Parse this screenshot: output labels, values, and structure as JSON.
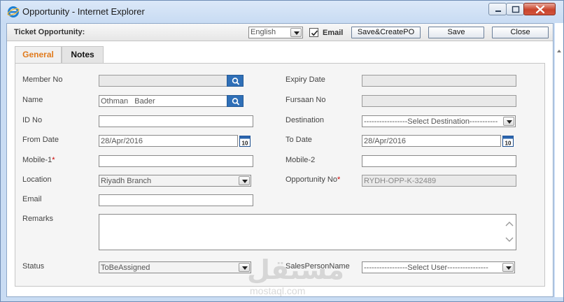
{
  "window": {
    "title": "Opportunity - Internet Explorer"
  },
  "toolbar": {
    "title": "Ticket Opportunity:",
    "language": "English",
    "email_label": "Email",
    "email_checked": true,
    "save_po_label": "Save&CreatePO",
    "save_label": "Save",
    "close_label": "Close"
  },
  "tabs": [
    {
      "label": "General",
      "active": true
    },
    {
      "label": "Notes",
      "active": false
    }
  ],
  "form": {
    "member_no": {
      "label": "Member No",
      "value": ""
    },
    "expiry_date": {
      "label": "Expiry Date",
      "value": ""
    },
    "name": {
      "label": "Name",
      "value": "Othman   Bader"
    },
    "fursaan_no": {
      "label": "Fursaan No",
      "value": ""
    },
    "id_no": {
      "label": "ID No",
      "value": ""
    },
    "destination": {
      "label": "Destination",
      "value": "-----------------Select Destination-----------"
    },
    "from_date": {
      "label": "From Date",
      "value": "28/Apr/2016"
    },
    "to_date": {
      "label": "To Date",
      "value": "28/Apr/2016"
    },
    "mobile1": {
      "label": "Mobile-1",
      "required": "*",
      "value": ""
    },
    "mobile2": {
      "label": "Mobile-2",
      "value": ""
    },
    "location": {
      "label": "Location",
      "value": "Riyadh Branch"
    },
    "opportunity_no": {
      "label": "Opportunity No",
      "required": "*",
      "value": "RYDH-OPP-K-32489"
    },
    "email": {
      "label": "Email",
      "value": ""
    },
    "remarks": {
      "label": "Remarks",
      "value": ""
    },
    "status": {
      "label": "Status",
      "value": "ToBeAssigned"
    },
    "salesperson": {
      "label": "SalesPersonName",
      "value": "-----------------Select User----------------"
    }
  },
  "calendar_icon_day": "10",
  "watermark": {
    "script": "مستقل",
    "word": "mostaql.com"
  },
  "colors": {
    "accent_tab": "#e07a1c",
    "search_button": "#2f6fb7",
    "required_star": "#cc0000"
  }
}
